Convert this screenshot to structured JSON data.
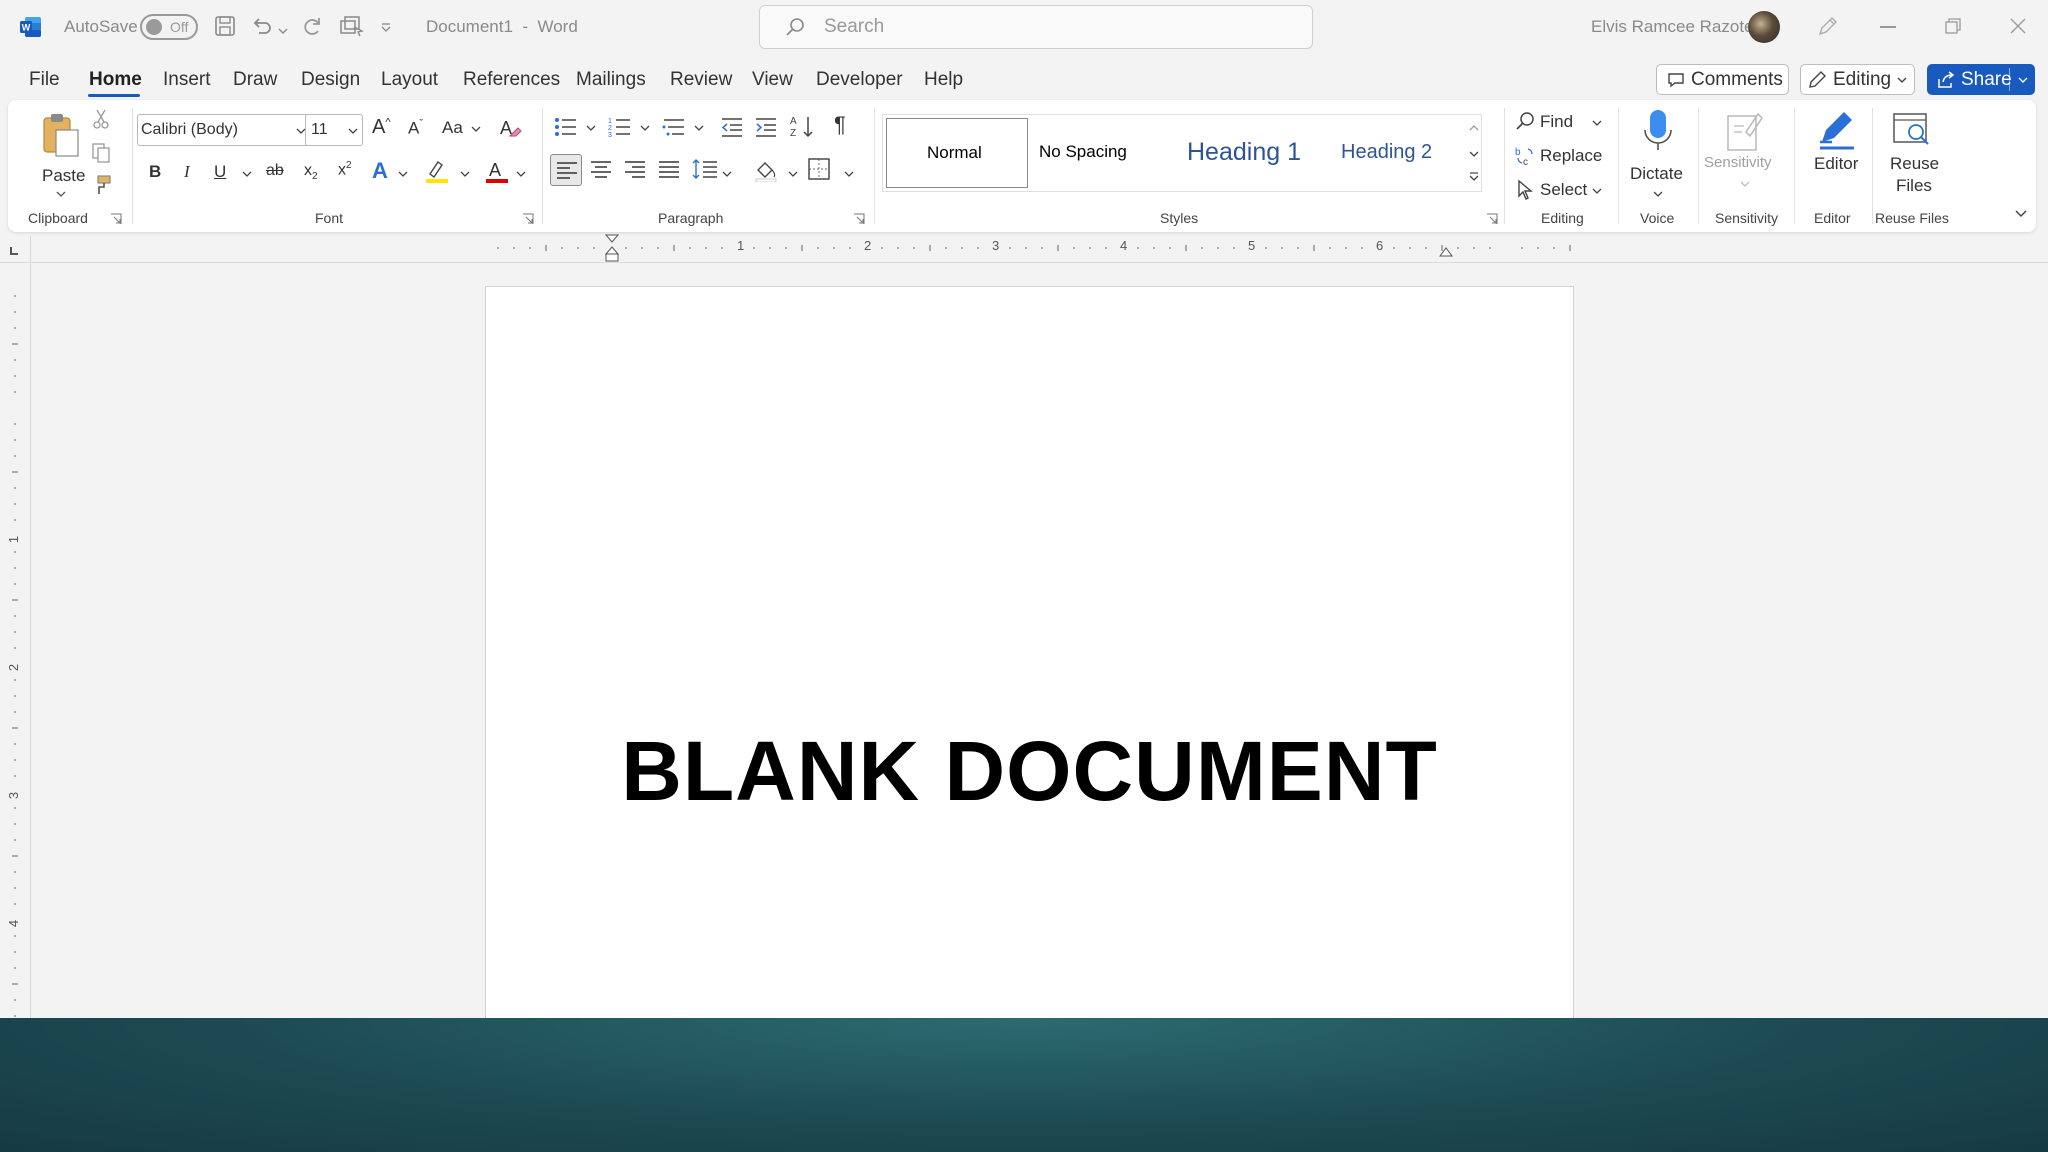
{
  "titlebar": {
    "autosave_label": "AutoSave",
    "autosave_state": "Off",
    "doc_title": "Document1  -  Word",
    "search_placeholder": "Search",
    "user_name": "Elvis Ramcee Razote"
  },
  "menu": {
    "tabs": [
      "File",
      "Home",
      "Insert",
      "Draw",
      "Design",
      "Layout",
      "References",
      "Mailings",
      "Review",
      "View",
      "Developer",
      "Help"
    ],
    "active_tab": "Home",
    "comments_label": "Comments",
    "editing_label": "Editing",
    "share_label": "Share"
  },
  "ribbon": {
    "clipboard": {
      "paste_label": "Paste",
      "group_label": "Clipboard"
    },
    "font": {
      "font_name": "Calibri (Body)",
      "font_size": "11",
      "case_label": "Aa",
      "group_label": "Font"
    },
    "paragraph": {
      "group_label": "Paragraph"
    },
    "styles": {
      "items": [
        "Normal",
        "No Spacing",
        "Heading 1",
        "Heading 2"
      ],
      "group_label": "Styles"
    },
    "editing": {
      "find_label": "Find",
      "replace_label": "Replace",
      "select_label": "Select",
      "group_label": "Editing"
    },
    "voice": {
      "dictate_label": "Dictate",
      "group_label": "Voice"
    },
    "sensitivity": {
      "button_label": "Sensitivity",
      "group_label": "Sensitivity"
    },
    "editor": {
      "button_label": "Editor",
      "group_label": "Editor"
    },
    "reuse": {
      "button_label_1": "Reuse",
      "button_label_2": "Files",
      "group_label": "Reuse Files"
    }
  },
  "ruler": {
    "numbers": [
      "1",
      "2",
      "3",
      "4",
      "5",
      "6"
    ],
    "vertical_numbers": [
      "1",
      "2",
      "3",
      "4"
    ]
  },
  "document": {
    "body_text": "BLANK DOCUMENT"
  },
  "colors": {
    "accent": "#185abd",
    "window_bg": "#f3f3f3",
    "desktop_bg": "#1f4a52"
  }
}
